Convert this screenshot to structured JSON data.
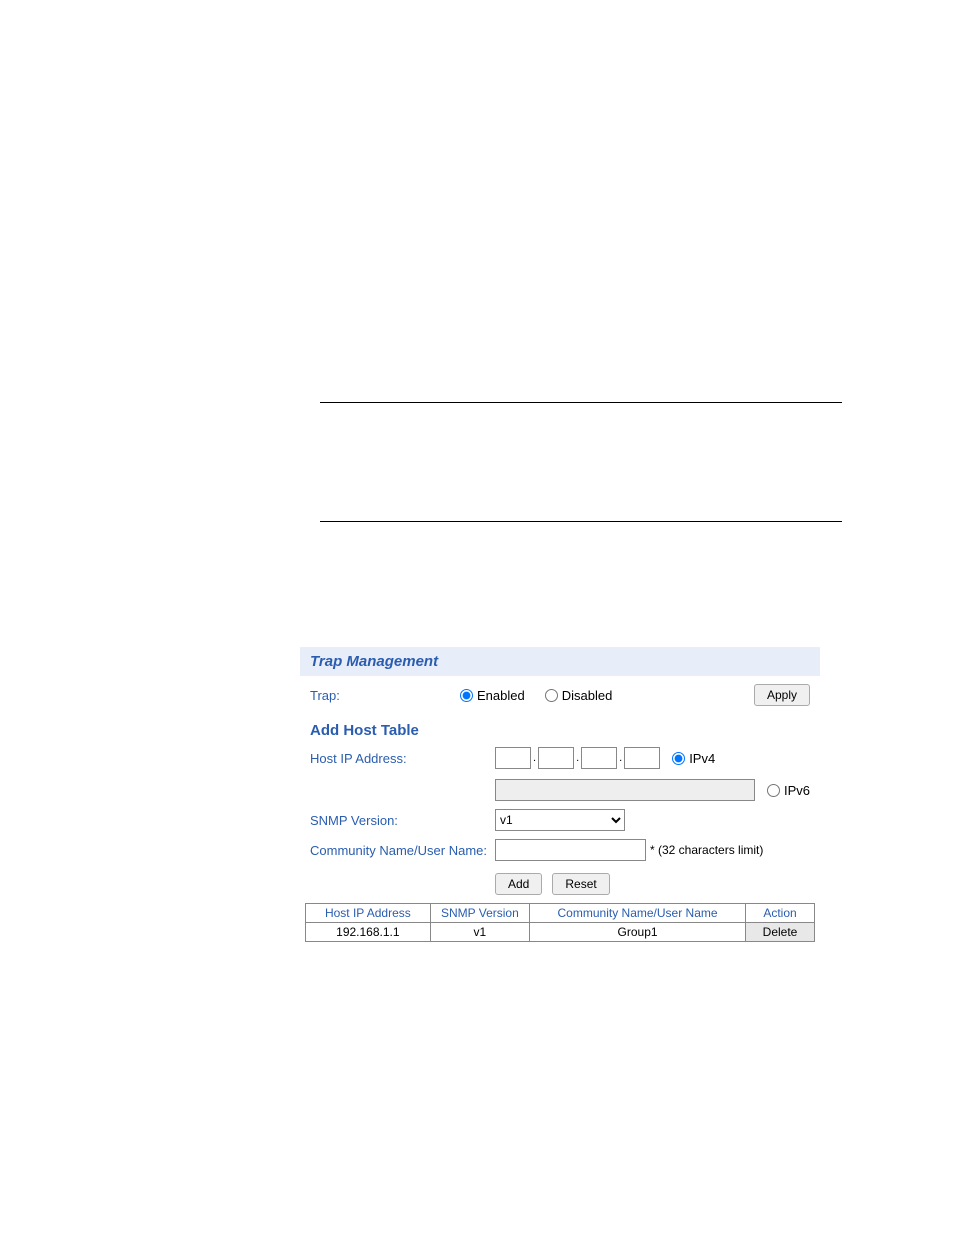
{
  "panel": {
    "title": "Trap Management"
  },
  "trap": {
    "label": "Trap:",
    "enabled_label": "Enabled",
    "disabled_label": "Disabled",
    "apply_button": "Apply"
  },
  "add_host": {
    "section_title": "Add Host Table",
    "host_ip_label": "Host IP Address:",
    "ipv4_label": "IPv4",
    "ipv6_label": "IPv6",
    "snmp_version_label": "SNMP Version:",
    "snmp_version_value": "v1",
    "community_label": "Community Name/User Name:",
    "community_hint": "* (32 characters limit)",
    "add_button": "Add",
    "reset_button": "Reset"
  },
  "table": {
    "headers": {
      "host_ip": "Host IP Address",
      "snmp_version": "SNMP Version",
      "community": "Community Name/User Name",
      "action": "Action"
    },
    "rows": [
      {
        "host_ip": "192.168.1.1",
        "snmp_version": "v1",
        "community": "Group1",
        "action": "Delete"
      }
    ]
  }
}
